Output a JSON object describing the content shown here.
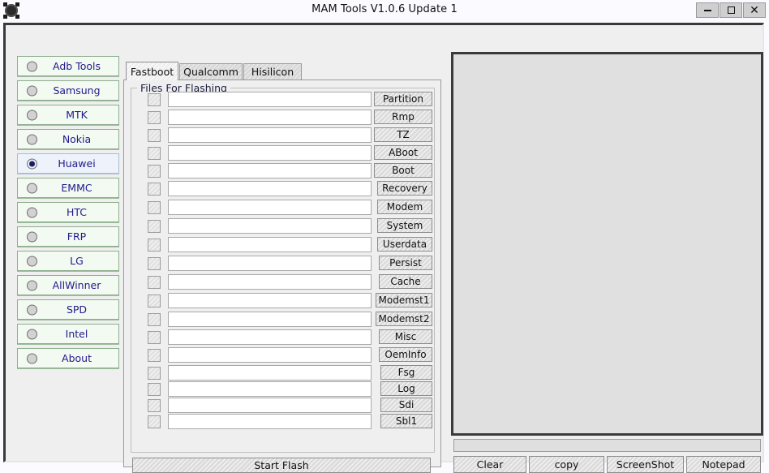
{
  "window": {
    "title": "MAM Tools V1.0.6 Update 1",
    "icon": "app-logo-icon",
    "controls": {
      "minimize": "–",
      "maximize": "☐",
      "close": "✕"
    }
  },
  "sidebar": {
    "selected": "Huawei",
    "items": [
      {
        "label": "Adb Tools",
        "selected": false
      },
      {
        "label": "Samsung",
        "selected": false
      },
      {
        "label": "MTK",
        "selected": false
      },
      {
        "label": "Nokia",
        "selected": false
      },
      {
        "label": "Huawei",
        "selected": true
      },
      {
        "label": "EMMC",
        "selected": false
      },
      {
        "label": "HTC",
        "selected": false
      },
      {
        "label": "FRP",
        "selected": false
      },
      {
        "label": "LG",
        "selected": false
      },
      {
        "label": "AllWinner",
        "selected": false
      },
      {
        "label": "SPD",
        "selected": false
      },
      {
        "label": "Intel",
        "selected": false
      },
      {
        "label": "About",
        "selected": false
      }
    ]
  },
  "tabs": {
    "active_index": 0,
    "items": [
      {
        "label": "Fastboot"
      },
      {
        "label": "Qualcomm"
      },
      {
        "label": "Hisilicon"
      }
    ]
  },
  "group": {
    "title": "Files For Flashing"
  },
  "file_rows": [
    {
      "button": "Partition",
      "value": "",
      "checked": false,
      "btn_width": 72
    },
    {
      "button": "Rmp",
      "value": "",
      "checked": false,
      "btn_width": 72
    },
    {
      "button": "TZ",
      "value": "",
      "checked": false,
      "btn_width": 72
    },
    {
      "button": "ABoot",
      "value": "",
      "checked": false,
      "btn_width": 72
    },
    {
      "button": "Boot",
      "value": "",
      "checked": false,
      "btn_width": 72
    },
    {
      "button": "Recovery",
      "value": "",
      "checked": false,
      "btn_width": 68
    },
    {
      "button": "Modem",
      "value": "",
      "checked": false,
      "btn_width": 68
    },
    {
      "button": "System",
      "value": "",
      "checked": false,
      "btn_width": 68
    },
    {
      "button": "Userdata",
      "value": "",
      "checked": false,
      "btn_width": 68
    },
    {
      "button": "Persist",
      "value": "",
      "checked": false,
      "btn_width": 66
    },
    {
      "button": "Cache",
      "value": "",
      "checked": false,
      "btn_width": 66
    },
    {
      "button": "Modemst1",
      "value": "",
      "checked": false,
      "btn_width": 70
    },
    {
      "button": "Modemst2",
      "value": "",
      "checked": false,
      "btn_width": 70
    },
    {
      "button": "Misc",
      "value": "",
      "checked": false,
      "btn_width": 66
    },
    {
      "button": "OemInfo",
      "value": "",
      "checked": false,
      "btn_width": 66
    },
    {
      "button": "Fsg",
      "value": "",
      "checked": false,
      "btn_width": 64
    },
    {
      "button": "Log",
      "value": "",
      "checked": false,
      "btn_width": 64
    },
    {
      "button": "Sdi",
      "value": "",
      "checked": false,
      "btn_width": 64
    },
    {
      "button": "Sbl1",
      "value": "",
      "checked": false,
      "btn_width": 64
    }
  ],
  "actions": {
    "start_flash": "Start Flash"
  },
  "log": {
    "content": ""
  },
  "progress": {
    "percent": 0
  },
  "bottom_buttons": {
    "clear": "Clear",
    "copy": "copy",
    "screenshot": "ScreenShot",
    "notepad": "Notepad"
  },
  "colors": {
    "sidebar_item_bg": "#f2faf1",
    "sidebar_item_selected_bg": "#eef3fb",
    "sidebar_text": "#231a8c",
    "window_bg": "#efefef",
    "log_bg": "#e0e0e0",
    "frame_dark": "#3a3a3c"
  }
}
